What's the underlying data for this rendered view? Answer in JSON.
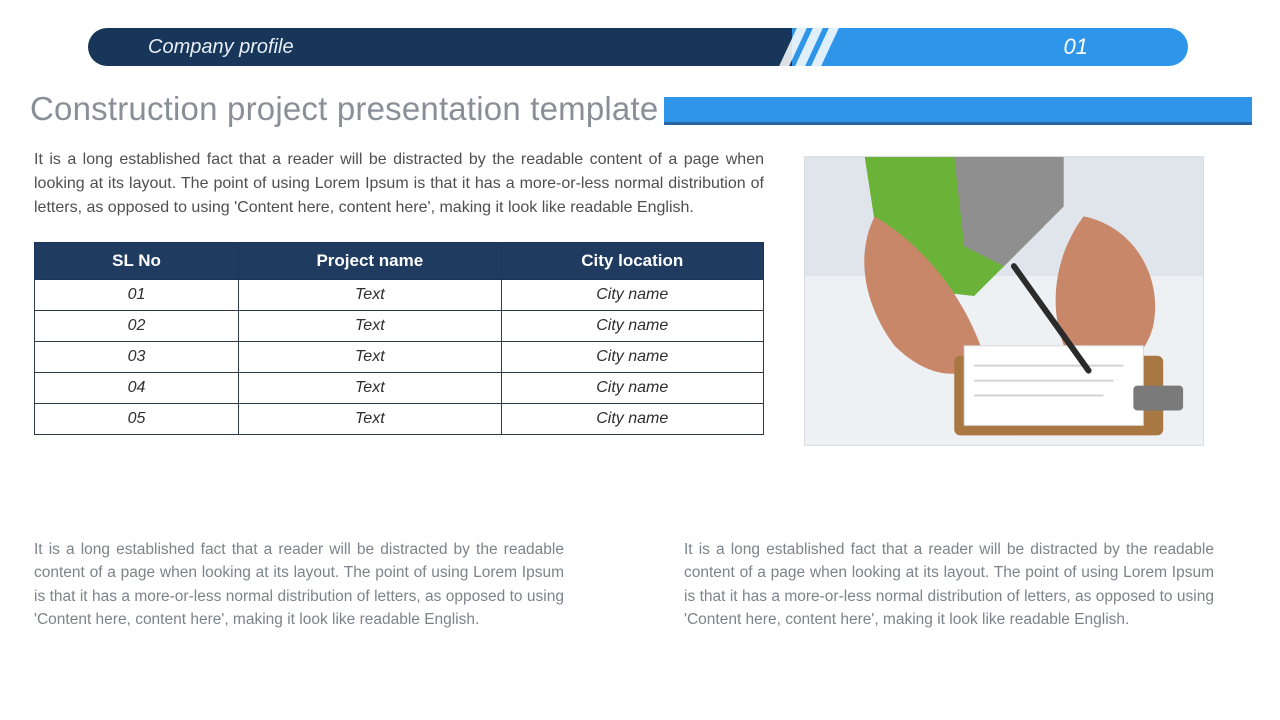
{
  "header": {
    "label": "Company profile",
    "slide_number": "01"
  },
  "title": "Construction project presentation template",
  "intro_paragraph": "It is a long established fact that a reader will be distracted by the readable content of a page when looking at its layout. The point of using Lorem Ipsum is that it has a more-or-less normal distribution of letters, as opposed to using 'Content here, content here', making it look like readable English.",
  "table": {
    "headers": [
      "SL No",
      "Project name",
      "City location"
    ],
    "rows": [
      {
        "sl": "01",
        "name": "Text",
        "city": "City name"
      },
      {
        "sl": "02",
        "name": "Text",
        "city": "City name"
      },
      {
        "sl": "03",
        "name": "Text",
        "city": "City name"
      },
      {
        "sl": "04",
        "name": "Text",
        "city": "City name"
      },
      {
        "sl": "05",
        "name": "Text",
        "city": "City name"
      }
    ]
  },
  "image": {
    "description": "Construction worker in green and grey shirt writing on a clipboard with pen, viewed from above"
  },
  "bottom_left": "It is a long established fact that a reader will be distracted by the readable content of a page when looking at its layout. The point of using Lorem Ipsum is that it has a more-or-less normal distribution of letters, as opposed to using 'Content here, content here', making it look like readable English.",
  "bottom_right": "It is a long established fact that a reader will be distracted by the readable content of a page when looking at its layout. The point of using Lorem Ipsum is that it has a more-or-less normal distribution of letters, as opposed to using 'Content here, content here', making it look like readable English."
}
